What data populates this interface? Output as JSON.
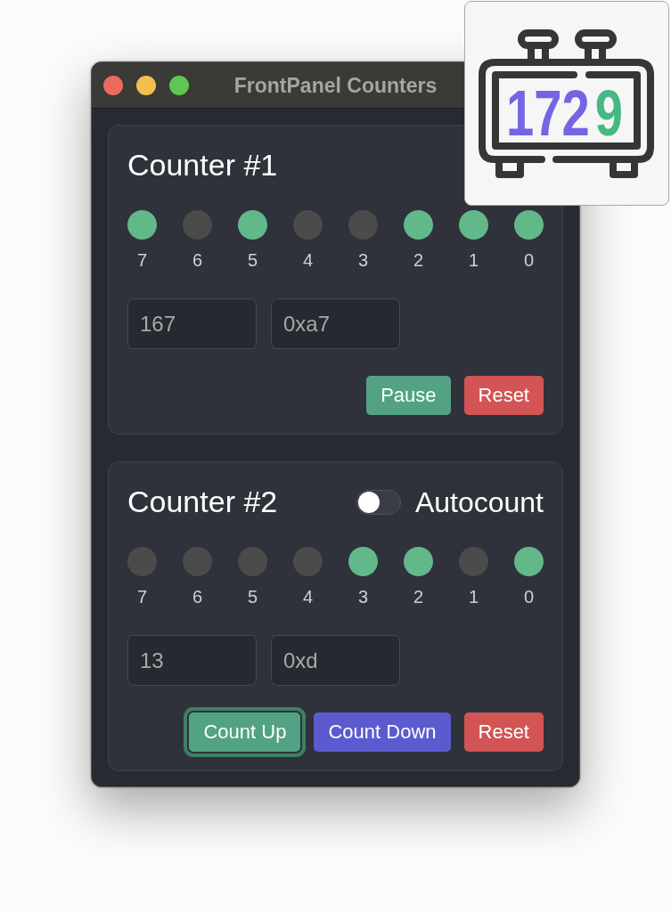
{
  "window": {
    "title": "FrontPanel Counters"
  },
  "counters": [
    {
      "title": "Counter #1",
      "bits": [
        {
          "label": "7",
          "on": true
        },
        {
          "label": "6",
          "on": false
        },
        {
          "label": "5",
          "on": true
        },
        {
          "label": "4",
          "on": false
        },
        {
          "label": "3",
          "on": false
        },
        {
          "label": "2",
          "on": true
        },
        {
          "label": "1",
          "on": true
        },
        {
          "label": "0",
          "on": true
        }
      ],
      "fields": [
        {
          "value": "167"
        },
        {
          "value": "0xa7"
        }
      ],
      "buttons": [
        {
          "label": "Pause",
          "kind": "success",
          "focused": false
        },
        {
          "label": "Reset",
          "kind": "danger",
          "focused": false
        }
      ]
    },
    {
      "title": "Counter #2",
      "autocount": {
        "label": "Autocount",
        "on": false
      },
      "bits": [
        {
          "label": "7",
          "on": false
        },
        {
          "label": "6",
          "on": false
        },
        {
          "label": "5",
          "on": false
        },
        {
          "label": "4",
          "on": false
        },
        {
          "label": "3",
          "on": true
        },
        {
          "label": "2",
          "on": true
        },
        {
          "label": "1",
          "on": false
        },
        {
          "label": "0",
          "on": true
        }
      ],
      "fields": [
        {
          "value": "13"
        },
        {
          "value": "0xd"
        }
      ],
      "buttons": [
        {
          "label": "Count Up",
          "kind": "success",
          "focused": true
        },
        {
          "label": "Count Down",
          "kind": "primary",
          "focused": false
        },
        {
          "label": "Reset",
          "kind": "danger",
          "focused": false
        }
      ]
    }
  ],
  "logo": {
    "digits": [
      {
        "text": "172",
        "color": "#7466e2"
      },
      {
        "text": "9",
        "color": "#45b984"
      }
    ]
  }
}
